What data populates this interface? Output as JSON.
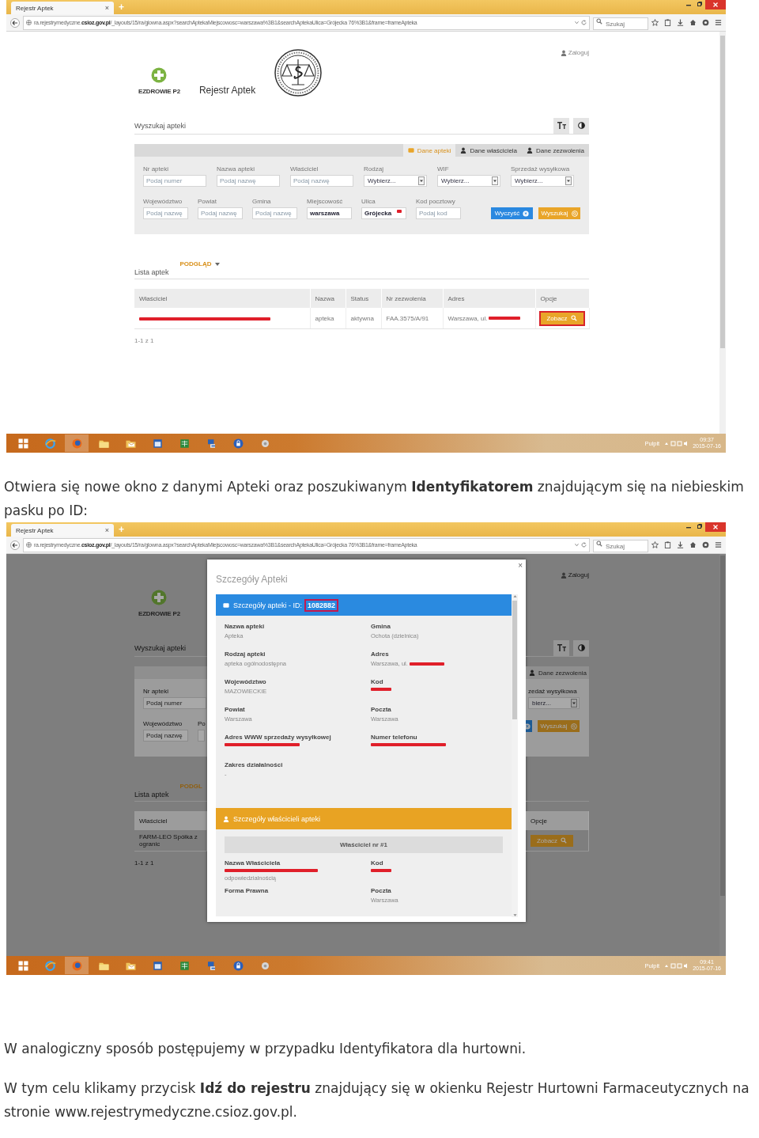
{
  "screenshot_1": {
    "browser": {
      "tab_title": "Rejestr Aptek",
      "tab_close": "×",
      "new_tab": "+",
      "url": "ra.rejestrymedyczne.**csioz.gov.pl**/_layouts/15/ra/glowna.aspx?searchAptekaMiejscowosc=warszawa%3B1&searchAptekaUlica=Grójecka 76%3B1&frame=frameApteka",
      "search_placeholder": "Szukaj"
    },
    "page": {
      "login": "Zaloguj",
      "logo_text": "EZDROWIE P2",
      "site_title": "Rejestr Aptek",
      "search_title": "Wyszukaj apteki",
      "form_tabs": [
        {
          "label": "Dane apteki",
          "kind": "card",
          "selected": true
        },
        {
          "label": "Dane właściciela",
          "kind": "person",
          "selected": false
        },
        {
          "label": "Dane zezwolenia",
          "kind": "person",
          "selected": false
        }
      ],
      "form_rows": [
        [
          {
            "label": "Nr apteki",
            "kind": "input",
            "placeholder": "Podaj numer"
          },
          {
            "label": "Nazwa apteki",
            "kind": "input",
            "placeholder": "Podaj nazwę"
          },
          {
            "label": "Właściciel",
            "kind": "input",
            "placeholder": "Podaj nazwę"
          },
          {
            "label": "Rodzaj",
            "kind": "select",
            "value": "Wybierz..."
          },
          {
            "label": "WIF",
            "kind": "select",
            "value": "Wybierz..."
          },
          {
            "label": "Sprzedaż wysyłkowa",
            "kind": "select",
            "value": "Wybierz..."
          }
        ],
        [
          {
            "label": "Województwo",
            "kind": "input",
            "placeholder": "Podaj nazwę"
          },
          {
            "label": "Powiat",
            "kind": "input",
            "placeholder": "Podaj nazwę"
          },
          {
            "label": "Gmina",
            "kind": "input",
            "placeholder": "Podaj nazwę"
          },
          {
            "label": "Miejscowość",
            "kind": "input",
            "value": "warszawa"
          },
          {
            "label": "Ulica",
            "kind": "input",
            "value": "Grójecka",
            "redacted": true
          },
          {
            "label": "Kod pocztowy",
            "kind": "input",
            "placeholder": "Podaj kod"
          }
        ]
      ],
      "form_buttons": [
        {
          "label": "Wyczyść",
          "kind": "clear"
        },
        {
          "label": "Wyszukaj",
          "kind": "search"
        }
      ],
      "list_title": "Lista aptek",
      "view_menu": "PODGLĄD",
      "table": {
        "columns": [
          "Właściciel",
          "Nazwa",
          "Status",
          "Nr zezwolenia",
          "Adres",
          "Opcje"
        ],
        "rows": [
          {
            "cells": [
              {
                "kind": "redacted"
              },
              {
                "kind": "text",
                "text": "apteka"
              },
              {
                "kind": "text",
                "text": "aktywna"
              },
              {
                "kind": "text",
                "text": "FAA.3575/A/91"
              },
              {
                "kind": "text",
                "text": "Warszawa, ul.",
                "redacted": true
              },
              {
                "kind": "button",
                "text": "Zobacz",
                "highlighted": true
              }
            ]
          }
        ]
      },
      "pagination": "1-1 z 1"
    },
    "taskbar": {
      "desktop_label": "Pulpit",
      "time": "09:37",
      "date": "2015-07-16"
    }
  },
  "caption_1": "Otwiera się nowe okno z danymi Apteki oraz poszukiwanym **Identyfikatorem** znajdującym się na niebieskim pasku po ID:",
  "screenshot_2": {
    "browser": {
      "tab_title": "Rejestr Aptek",
      "tab_close": "×",
      "new_tab": "+",
      "url": "ra.rejestrymedyczne.**csioz.gov.pl**/_layouts/15/ra/glowna.aspx?searchAptekaMiejscowosc=warszawa%3B1&searchAptekaUlica=Grójecka 76%3B1&frame=frameApteka",
      "search_placeholder": "Szukaj"
    },
    "background": {
      "left": {
        "logo_text": "EZDROWIE P2",
        "search_title": "Wyszukaj apteki",
        "fields": [
          {
            "label": "Nr apteki",
            "placeholder": "Podaj numer"
          },
          {
            "label": "Województwo",
            "placeholder": "Podaj nazwę"
          }
        ],
        "cut_label": "Po",
        "view_menu": "PODGL",
        "list_title": "Lista aptek",
        "column": "Właściciel",
        "owner": "FARM-LEO Spółka z ogranic",
        "pagination": "1-1 z 1"
      },
      "right": {
        "login": "Zaloguj",
        "tab": "Dane zezwolenia",
        "label": "zedaż wysyłkowa",
        "select_value": "bierz...",
        "search_button": "Wyszukaj",
        "column": "Opcje",
        "view_button": "Zobacz"
      }
    },
    "modal": {
      "close": "×",
      "title": "Szczegóły Apteki",
      "section_title": "Szczegóły apteki - ID:",
      "id": "1082882",
      "id_highlighted": true,
      "fields": [
        {
          "label": "Nazwa apteki",
          "kind": "text",
          "value": "Apteka"
        },
        {
          "label": "Gmina",
          "kind": "text",
          "value": "Ochota (dzielnica)"
        },
        {
          "label": "Rodzaj apteki",
          "kind": "text",
          "value": "apteka ogólnodostępna"
        },
        {
          "label": "Adres",
          "kind": "text_then_redacted",
          "value": "Warszawa, ul."
        },
        {
          "label": "Województwo",
          "kind": "text",
          "value": "MAZOWIECKIE"
        },
        {
          "label": "Kod",
          "kind": "redacted_short"
        },
        {
          "label": "Powiat",
          "kind": "text",
          "value": "Warszawa"
        },
        {
          "label": "Poczta",
          "kind": "text",
          "value": "Warszawa"
        },
        {
          "label": "Adres WWW sprzedaży wysyłkowej",
          "kind": "redacted_long"
        },
        {
          "label": "Numer telefonu",
          "kind": "redacted_long"
        }
      ],
      "scope_label": "Zakres działalności",
      "scope_value": "-",
      "owner_section": "Szczegóły właścicieli apteki",
      "owner_title": "Właściciel nr #1",
      "owner_fields": [
        {
          "label": "Nazwa Właściciela",
          "kind": "redacted_then_text",
          "value": "odpowiedzialnością"
        },
        {
          "label": "Kod",
          "kind": "redacted_short"
        },
        {
          "label": "Forma Prawna",
          "kind": "text"
        },
        {
          "label": "Poczta",
          "kind": "text",
          "value": "Warszawa"
        }
      ]
    },
    "taskbar": {
      "desktop_label": "Pulpit",
      "time": "09:41",
      "date": "2015-07-16"
    }
  },
  "closing_paragraphs": [
    "W analogiczny sposób postępujemy w przypadku Identyfikatora dla hurtowni.",
    "W tym celu klikamy przycisk **Idź do rejestru** znajdujący się w okienku Rejestr Hurtowni Farmaceutycznych na stronie www.rejestrymedyczne.csioz.gov.pl."
  ]
}
